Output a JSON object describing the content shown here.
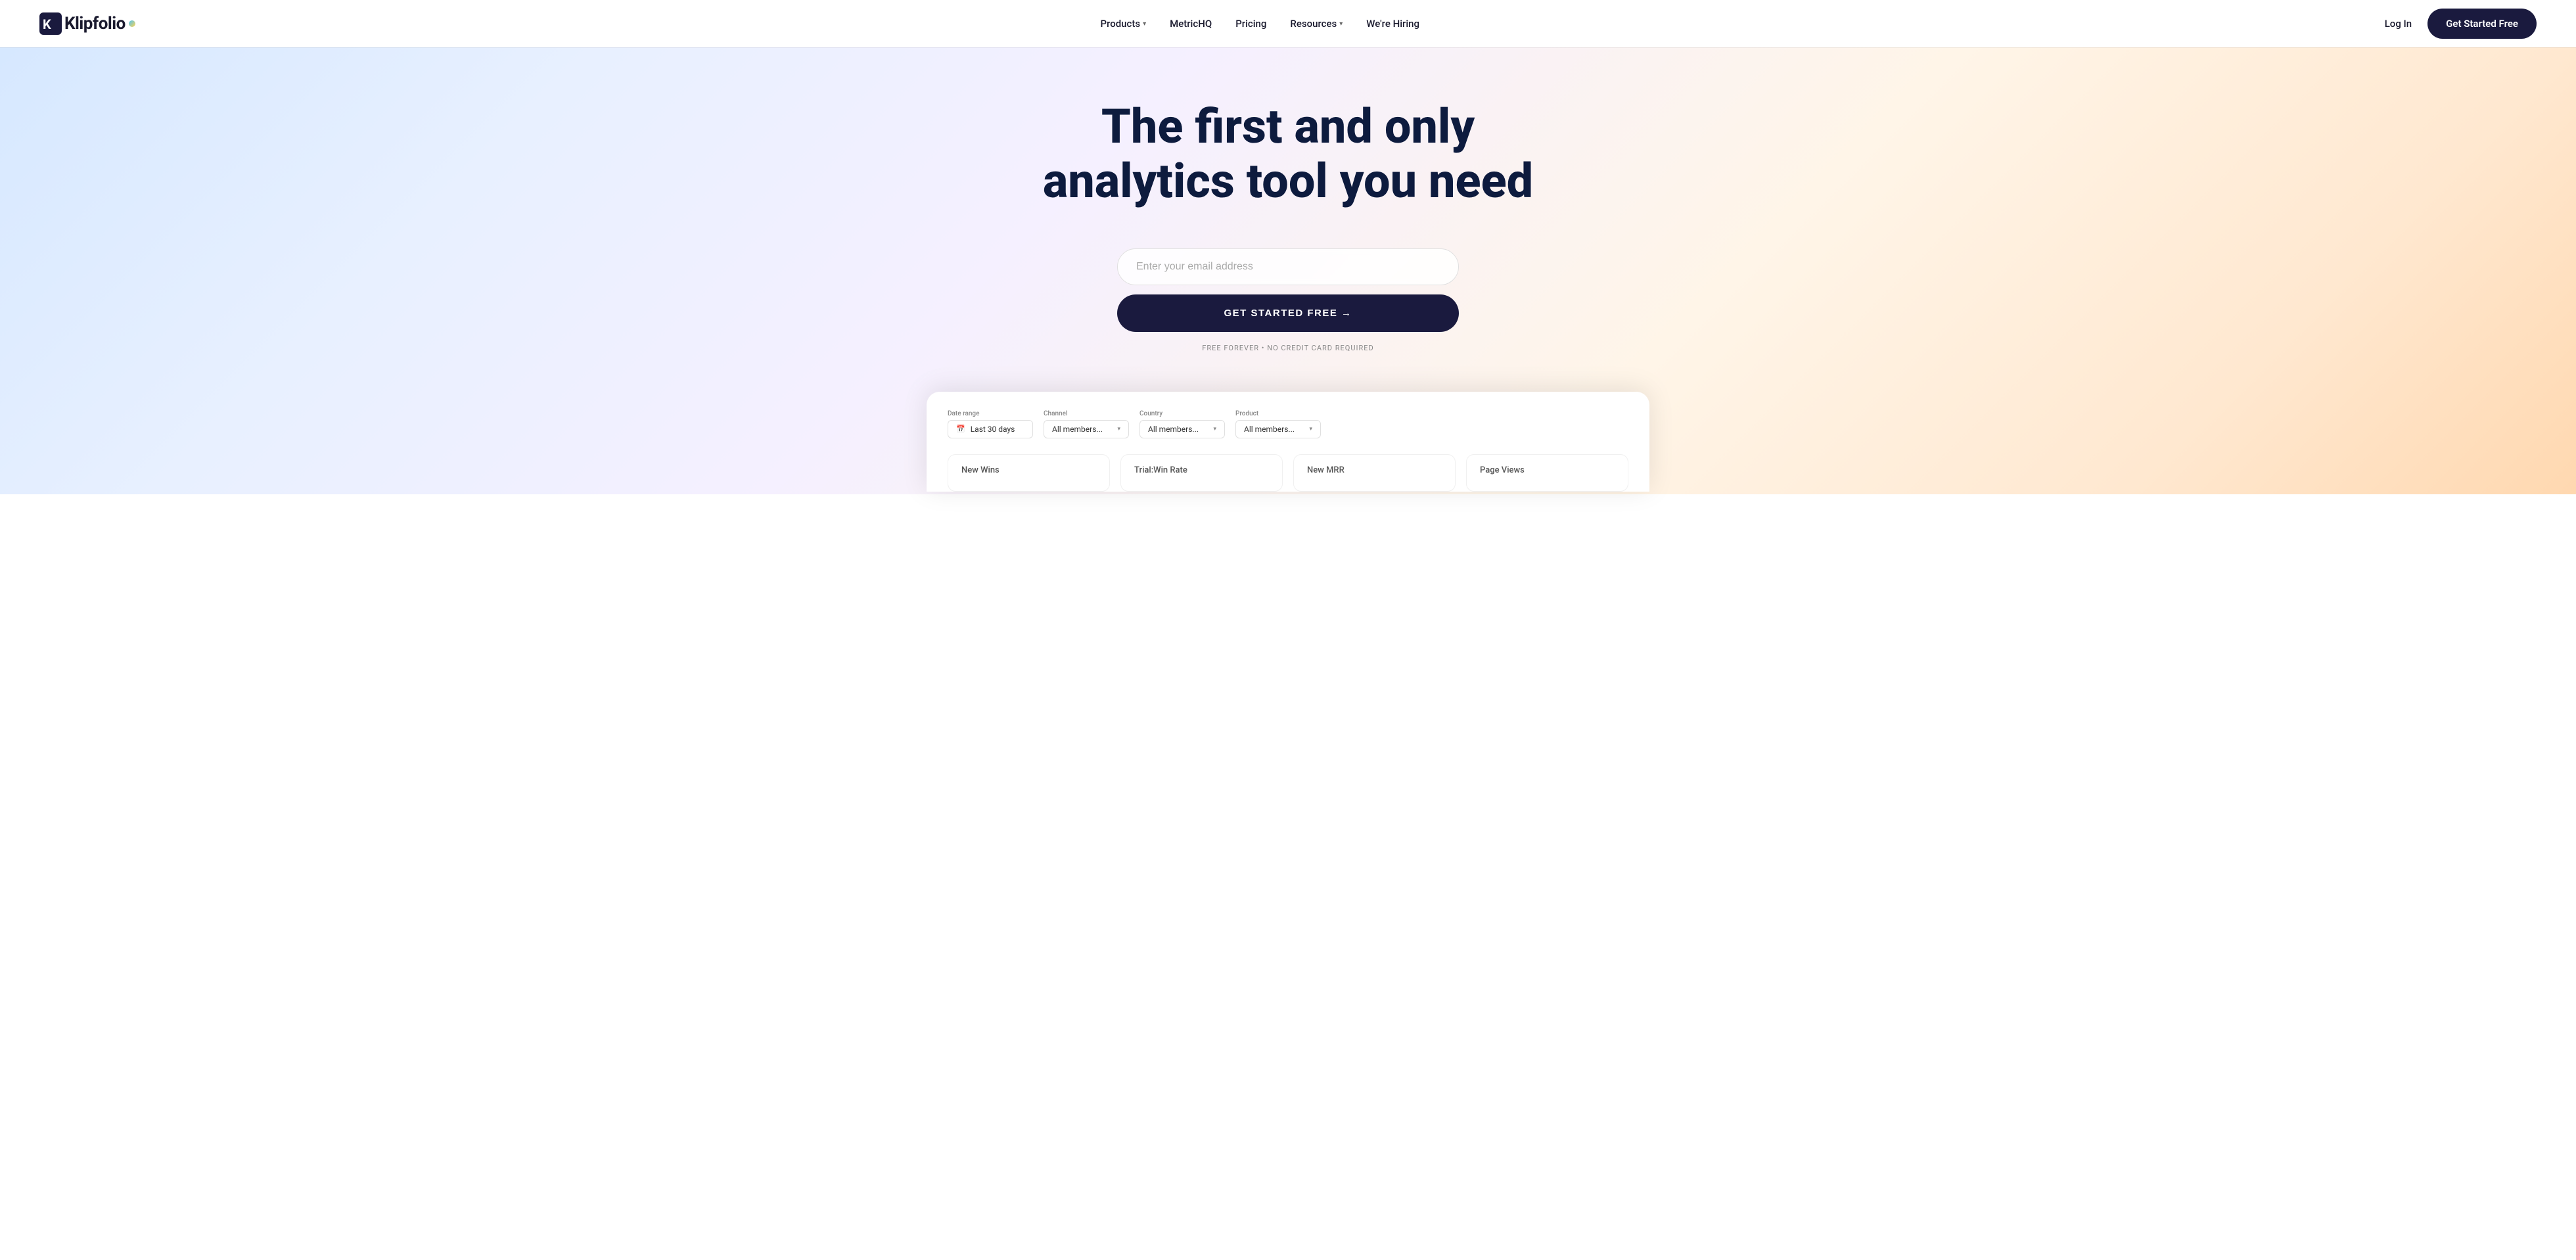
{
  "nav": {
    "logo_text": "Klipfolio",
    "links": [
      {
        "label": "Products",
        "has_dropdown": true
      },
      {
        "label": "MetricHQ",
        "has_dropdown": false
      },
      {
        "label": "Pricing",
        "has_dropdown": false
      },
      {
        "label": "Resources",
        "has_dropdown": true
      },
      {
        "label": "We're Hiring",
        "has_dropdown": false
      }
    ],
    "login_label": "Log In",
    "cta_label": "Get Started Free"
  },
  "hero": {
    "title_line1": "The first and only",
    "title_line2": "analytics tool you need",
    "email_placeholder": "Enter your email address",
    "cta_button": "GET STARTED FREE →",
    "disclaimer": "FREE FOREVER • NO CREDIT CARD REQUIRED"
  },
  "dashboard": {
    "filters": [
      {
        "label": "Date range",
        "value": "Last 30 days",
        "has_icon": true
      },
      {
        "label": "Channel",
        "value": "All members..."
      },
      {
        "label": "Country",
        "value": "All members..."
      },
      {
        "label": "Product",
        "value": "All members..."
      }
    ],
    "metrics": [
      {
        "title": "New Wins"
      },
      {
        "title": "Trial:Win Rate"
      },
      {
        "title": "New MRR"
      },
      {
        "title": "Page Views"
      }
    ]
  },
  "colors": {
    "dark_navy": "#1a1a3e",
    "cta_bg": "#1a1a3e",
    "text_primary": "#0d1b3e",
    "text_secondary": "#555",
    "accent_blue": "#4FC3F7",
    "accent_yellow": "#FFD54F"
  }
}
